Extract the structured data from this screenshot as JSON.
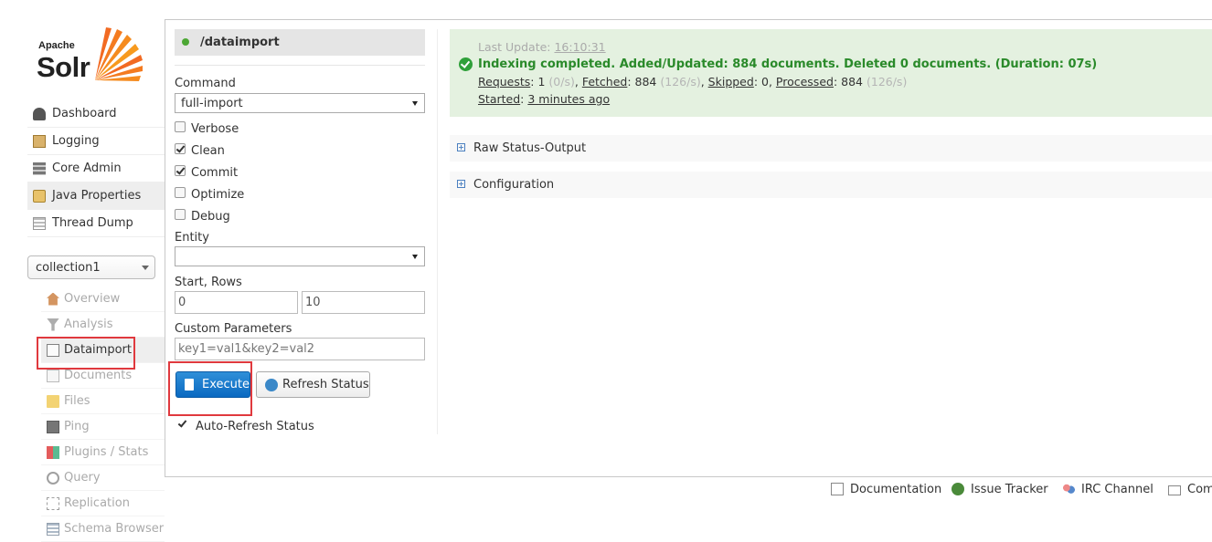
{
  "logo": {
    "apache": "Apache",
    "solr": "Solr"
  },
  "nav": [
    {
      "label": "Dashboard",
      "icon": "dashboard-icon"
    },
    {
      "label": "Logging",
      "icon": "logging-icon"
    },
    {
      "label": "Core Admin",
      "icon": "core-admin-icon"
    },
    {
      "label": "Java Properties",
      "icon": "java-properties-icon"
    },
    {
      "label": "Thread Dump",
      "icon": "thread-dump-icon"
    }
  ],
  "core_selector": {
    "value": "collection1"
  },
  "core_menu": [
    {
      "label": "Overview",
      "icon": "home-icon"
    },
    {
      "label": "Analysis",
      "icon": "funnel-icon"
    },
    {
      "label": "Dataimport",
      "icon": "document-import-icon"
    },
    {
      "label": "Documents",
      "icon": "documents-icon"
    },
    {
      "label": "Files",
      "icon": "folder-icon"
    },
    {
      "label": "Ping",
      "icon": "ping-icon"
    },
    {
      "label": "Plugins / Stats",
      "icon": "plugins-icon"
    },
    {
      "label": "Query",
      "icon": "magnifier-icon"
    },
    {
      "label": "Replication",
      "icon": "replication-icon"
    },
    {
      "label": "Schema Browser",
      "icon": "schema-icon"
    }
  ],
  "form": {
    "handler": "/dataimport",
    "command_label": "Command",
    "command_value": "full-import",
    "options": [
      {
        "label": "Verbose",
        "checked": false
      },
      {
        "label": "Clean",
        "checked": true
      },
      {
        "label": "Commit",
        "checked": true
      },
      {
        "label": "Optimize",
        "checked": false
      },
      {
        "label": "Debug",
        "checked": false
      }
    ],
    "entity_label": "Entity",
    "entity_value": "",
    "start_rows_label": "Start, Rows",
    "start_value": "0",
    "rows_value": "10",
    "custom_params_label": "Custom Parameters",
    "custom_params_value": "key1=val1&key2=val2",
    "execute_label": "Execute",
    "refresh_label": "Refresh Status",
    "auto_refresh_label": "Auto-Refresh Status",
    "auto_refresh_checked": true
  },
  "status": {
    "last_update_label": "Last Update:",
    "last_update_value": "16:10:31",
    "message": "Indexing completed. Added/Updated: 884 documents. Deleted 0 documents. (Duration: 07s)",
    "requests_label": "Requests",
    "requests_value": "1",
    "requests_rate": "(0/s)",
    "fetched_label": "Fetched",
    "fetched_value": "884",
    "fetched_rate": "(126/s)",
    "skipped_label": "Skipped",
    "skipped_value": "0",
    "processed_label": "Processed",
    "processed_value": "884",
    "processed_rate": "(126/s)",
    "started_label": "Started",
    "started_value": "3 minutes ago"
  },
  "sections": {
    "raw_status": "Raw Status-Output",
    "configuration": "Configuration"
  },
  "footer": {
    "documentation": "Documentation",
    "issue_tracker": "Issue Tracker",
    "irc_channel": "IRC Channel",
    "community": "Com"
  },
  "colors": {
    "accent_blue": "#0a69c1",
    "status_green": "#2a8a2a",
    "status_bg": "#e4f1e0",
    "highlight_red": "#e0393e"
  }
}
